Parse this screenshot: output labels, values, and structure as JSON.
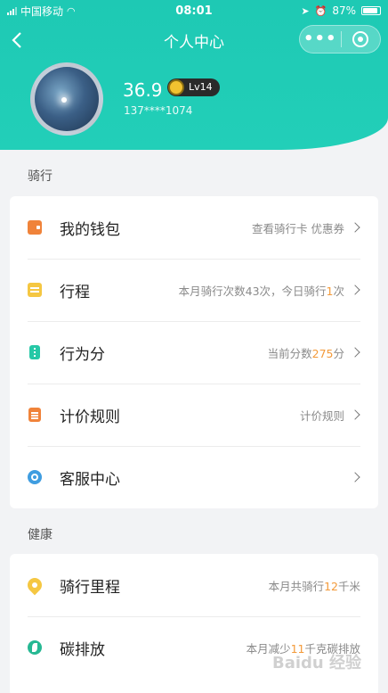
{
  "status_bar": {
    "carrier": "中国移动",
    "time": "08:01",
    "battery": "87%"
  },
  "nav": {
    "title": "个人中心",
    "more": "•••"
  },
  "profile": {
    "score": "36.9",
    "level": "Lv14",
    "phone": "137****1074"
  },
  "sections": {
    "riding": {
      "title": "骑行",
      "items": [
        {
          "label": "我的钱包",
          "sub": "查看骑行卡 优惠券"
        },
        {
          "label": "行程",
          "sub_pre": "本月骑行次数43次，今日骑行",
          "sub_hl": "1",
          "sub_post": "次"
        },
        {
          "label": "行为分",
          "sub_pre": "当前分数",
          "sub_hl": "275",
          "sub_post": "分"
        },
        {
          "label": "计价规则",
          "sub": "计价规则"
        },
        {
          "label": "客服中心",
          "sub": ""
        }
      ]
    },
    "health": {
      "title": "健康",
      "items": [
        {
          "label": "骑行里程",
          "sub_pre": "本月共骑行",
          "sub_hl": "12",
          "sub_post": "千米"
        },
        {
          "label": "碳排放",
          "sub_pre": "本月减少",
          "sub_hl": "11",
          "sub_post": "千克碳排放"
        }
      ]
    }
  },
  "watermark": "Baidu 经验",
  "colors": {
    "header": "#1ec9b4",
    "highlight": "#f39a3a"
  }
}
